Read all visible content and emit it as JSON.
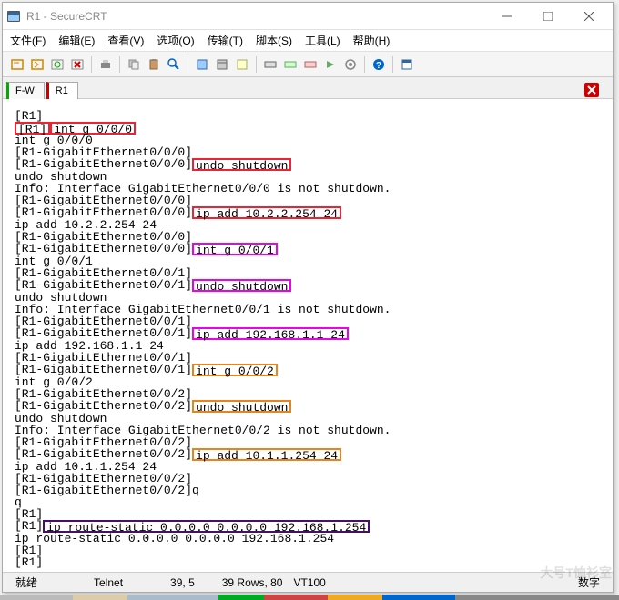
{
  "titlebar": {
    "title": "R1 - SecureCRT"
  },
  "menu": {
    "file": "文件(F)",
    "edit": "编辑(E)",
    "view": "查看(V)",
    "options": "选项(O)",
    "transfer": "传输(T)",
    "script": "脚本(S)",
    "tools": "工具(L)",
    "help": "帮助(H)"
  },
  "tabs": {
    "t1": "F-W",
    "t2": "R1"
  },
  "term": {
    "l1": "[R1]",
    "l2a": "[R1]",
    "l2b": "int g 0/0/0",
    "l3": "int g 0/0/0",
    "l4": "[R1-GigabitEthernet0/0/0]",
    "l5a": "[R1-GigabitEthernet0/0/0]",
    "l5b": "undo shutdown",
    "l6": "undo shutdown",
    "l7": "Info: Interface GigabitEthernet0/0/0 is not shutdown.",
    "l8": "[R1-GigabitEthernet0/0/0]",
    "l9a": "[R1-GigabitEthernet0/0/0]",
    "l9b": "ip add 10.2.2.254 24",
    "l10": "ip add 10.2.2.254 24",
    "l11": "[R1-GigabitEthernet0/0/0]",
    "l12a": "[R1-GigabitEthernet0/0/0]",
    "l12b": "int g 0/0/1",
    "l13": "int g 0/0/1",
    "l14": "[R1-GigabitEthernet0/0/1]",
    "l15a": "[R1-GigabitEthernet0/0/1]",
    "l15b": "undo shutdown",
    "l16": "undo shutdown",
    "l17": "Info: Interface GigabitEthernet0/0/1 is not shutdown.",
    "l18": "[R1-GigabitEthernet0/0/1]",
    "l19a": "[R1-GigabitEthernet0/0/1]",
    "l19b": "ip add 192.168.1.1 24",
    "l20": "ip add 192.168.1.1 24",
    "l21": "[R1-GigabitEthernet0/0/1]",
    "l22a": "[R1-GigabitEthernet0/0/1]",
    "l22b": "int g 0/0/2",
    "l23": "int g 0/0/2",
    "l24": "[R1-GigabitEthernet0/0/2]",
    "l25a": "[R1-GigabitEthernet0/0/2]",
    "l25b": "undo shutdown",
    "l26": "undo shutdown",
    "l27": "Info: Interface GigabitEthernet0/0/2 is not shutdown.",
    "l28": "[R1-GigabitEthernet0/0/2]",
    "l29a": "[R1-GigabitEthernet0/0/2]",
    "l29b": "ip add 10.1.1.254 24",
    "l30": "ip add 10.1.1.254 24",
    "l31": "[R1-GigabitEthernet0/0/2]",
    "l32": "[R1-GigabitEthernet0/0/2]q",
    "l33": "q",
    "l34": "[R1]",
    "l35a": "[R1]",
    "l35b": "ip route-static 0.0.0.0 0.0.0.0 192.168.1.254",
    "l36": "ip route-static 0.0.0.0 0.0.0.0 192.168.1.254",
    "l37": "[R1]",
    "l38": "[R1]"
  },
  "status": {
    "ready": "就绪",
    "proto": "Telnet",
    "pos": "39,  5",
    "rows": "39 Rows, 80",
    "emul": "VT100",
    "num": "数字"
  },
  "watermark": "大号T恤衫室"
}
